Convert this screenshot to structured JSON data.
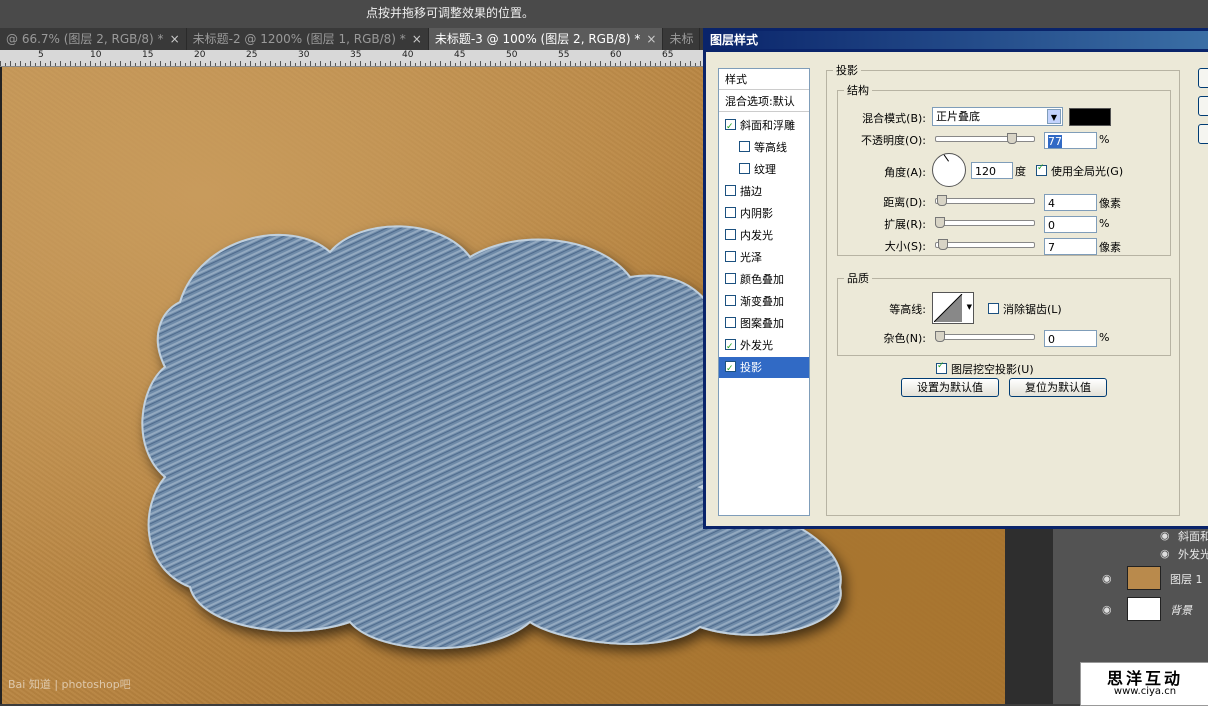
{
  "hint": "点按并拖移可调整效果的位置。",
  "tabs": [
    {
      "label": "@ 66.7% (图层 2, RGB/8) *",
      "active": false
    },
    {
      "label": "未标题-2 @ 1200% (图层 1, RGB/8) *",
      "active": false
    },
    {
      "label": "未标题-3 @ 100% (图层 2, RGB/8) *",
      "active": true
    },
    {
      "label": "未标",
      "active": false
    }
  ],
  "ruler": [
    "5",
    "10",
    "15",
    "20",
    "25",
    "30",
    "35",
    "40",
    "45",
    "50",
    "55",
    "60",
    "65"
  ],
  "watermark": "Bai 知道 | photoshop吧",
  "dialog": {
    "title": "图层样式",
    "style_list": {
      "header": "样式",
      "blend_options": "混合选项:默认",
      "items": [
        {
          "label": "斜面和浮雕",
          "checked": true,
          "indent": false,
          "selected": false
        },
        {
          "label": "等高线",
          "checked": false,
          "indent": true,
          "selected": false
        },
        {
          "label": "纹理",
          "checked": false,
          "indent": true,
          "selected": false
        },
        {
          "label": "描边",
          "checked": false,
          "indent": false,
          "selected": false
        },
        {
          "label": "内阴影",
          "checked": false,
          "indent": false,
          "selected": false
        },
        {
          "label": "内发光",
          "checked": false,
          "indent": false,
          "selected": false
        },
        {
          "label": "光泽",
          "checked": false,
          "indent": false,
          "selected": false
        },
        {
          "label": "颜色叠加",
          "checked": false,
          "indent": false,
          "selected": false
        },
        {
          "label": "渐变叠加",
          "checked": false,
          "indent": false,
          "selected": false
        },
        {
          "label": "图案叠加",
          "checked": false,
          "indent": false,
          "selected": false
        },
        {
          "label": "外发光",
          "checked": true,
          "indent": false,
          "selected": false
        },
        {
          "label": "投影",
          "checked": true,
          "indent": false,
          "selected": true
        }
      ]
    },
    "drop_shadow": {
      "legend": "投影",
      "structure": {
        "legend": "结构",
        "blend_mode_label": "混合模式(B):",
        "blend_mode_value": "正片叠底",
        "shadow_color": "#000000",
        "opacity_label": "不透明度(O):",
        "opacity_value": "77",
        "opacity_unit": "%",
        "angle_label": "角度(A):",
        "angle_value": "120",
        "angle_unit": "度",
        "global_light_label": "使用全局光(G)",
        "global_light_checked": true,
        "distance_label": "距离(D):",
        "distance_value": "4",
        "distance_unit": "像素",
        "spread_label": "扩展(R):",
        "spread_value": "0",
        "spread_unit": "%",
        "size_label": "大小(S):",
        "size_value": "7",
        "size_unit": "像素"
      },
      "quality": {
        "legend": "品质",
        "contour_label": "等高线:",
        "anti_alias_label": "消除锯齿(L)",
        "anti_alias_checked": false,
        "noise_label": "杂色(N):",
        "noise_value": "0",
        "noise_unit": "%"
      },
      "knockout_label": "图层挖空投影(U)",
      "knockout_checked": true,
      "set_default": "设置为默认值",
      "reset_default": "复位为默认值"
    }
  },
  "layers": {
    "effect_1": "斜面和",
    "effect_2": "外发光",
    "layer_1": "图层 1",
    "background": "背景"
  },
  "logo": {
    "name": "思洋互动",
    "url": "www.ciya.cn"
  }
}
